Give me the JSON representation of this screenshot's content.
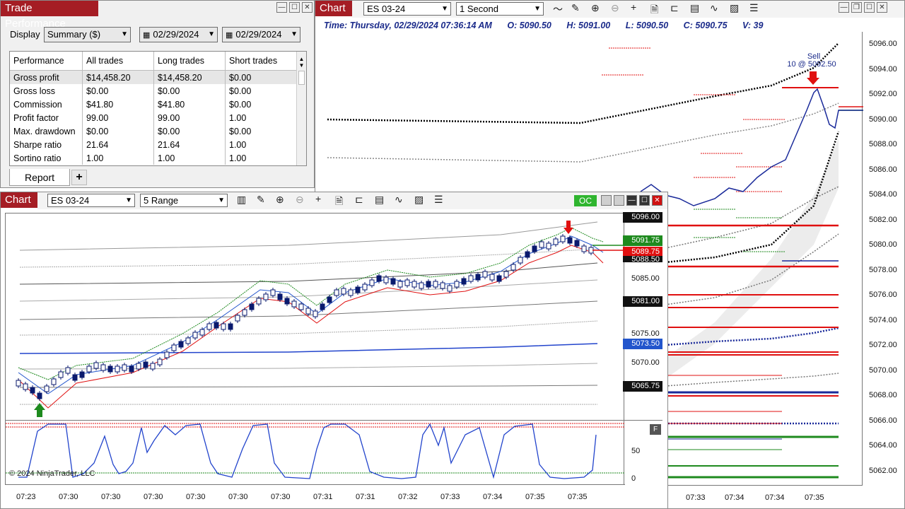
{
  "perf_window": {
    "title": "Trade Performance",
    "display_label": "Display",
    "display_value": "Summary ($)",
    "date_from": "02/29/2024",
    "date_to": "02/29/2024",
    "table_headers": [
      "Performance",
      "All trades",
      "Long trades",
      "Short trades"
    ],
    "rows": [
      [
        "Gross profit",
        "$14,458.20",
        "$14,458.20",
        "$0.00"
      ],
      [
        "Gross loss",
        "$0.00",
        "$0.00",
        "$0.00"
      ],
      [
        "Commission",
        "$41.80",
        "$41.80",
        "$0.00"
      ],
      [
        "Profit factor",
        "99.00",
        "99.00",
        "1.00"
      ],
      [
        "Max. drawdown",
        "$0.00",
        "$0.00",
        "$0.00"
      ],
      [
        "Sharpe ratio",
        "21.64",
        "21.64",
        "1.00"
      ],
      [
        "Sortino ratio",
        "1.00",
        "1.00",
        "1.00"
      ]
    ],
    "tab_report": "Report",
    "tab_add": "+"
  },
  "chart_top": {
    "title": "Chart",
    "instrument": "ES 03-24",
    "interval": "1 Second",
    "info": {
      "time": "Time: Thursday, 02/29/2024 07:36:14 AM",
      "open": "O: 5090.50",
      "high": "H: 5091.00",
      "low": "L: 5090.50",
      "close": "C: 5090.75",
      "volume": "V: 39"
    },
    "sell_label": "Sell",
    "sell_detail": "10 @ 5092.50",
    "y_ticks": [
      "5096.00",
      "5094.00",
      "5092.00",
      "5090.00",
      "5088.00",
      "5086.00",
      "5084.00",
      "5082.00",
      "5080.00",
      "5078.00",
      "5076.00",
      "5074.00",
      "5072.00",
      "5070.00",
      "5068.00",
      "5066.00",
      "5064.00",
      "5062.00"
    ],
    "x_ticks": [
      "07:33",
      "07:34",
      "07:34",
      "07:35"
    ]
  },
  "chart_bottom": {
    "title": "Chart",
    "instrument": "ES 03-24",
    "interval": "5 Range",
    "oc_label": "OC",
    "copyright": "© 2024 NinjaTrader, LLC",
    "price_tags": {
      "top": "5096.00",
      "green": "5091.75",
      "red": "5089.75",
      "under_red": "5088.50",
      "t5081": "5081.00",
      "t5073": "5073.50",
      "t5065": "5065.75"
    },
    "y_ticks": [
      "5085.00",
      "5075.00",
      "5070.00"
    ],
    "osc_ticks": [
      "50",
      "0"
    ],
    "osc_badge": "F",
    "x_ticks": [
      "07:23",
      "07:30",
      "07:30",
      "07:30",
      "07:30",
      "07:30",
      "07:30",
      "07:31",
      "07:31",
      "07:32",
      "07:33",
      "07:34",
      "07:35",
      "07:35"
    ]
  },
  "colors": {
    "title_bar": "#a51d24",
    "candle_down": "#0a1a6e",
    "price_line": "#1a2a9a",
    "green_tag": "#1e8a1e",
    "red_tag": "#e01010",
    "blue_tag": "#2255cc",
    "oc_green": "#2fb52f"
  }
}
